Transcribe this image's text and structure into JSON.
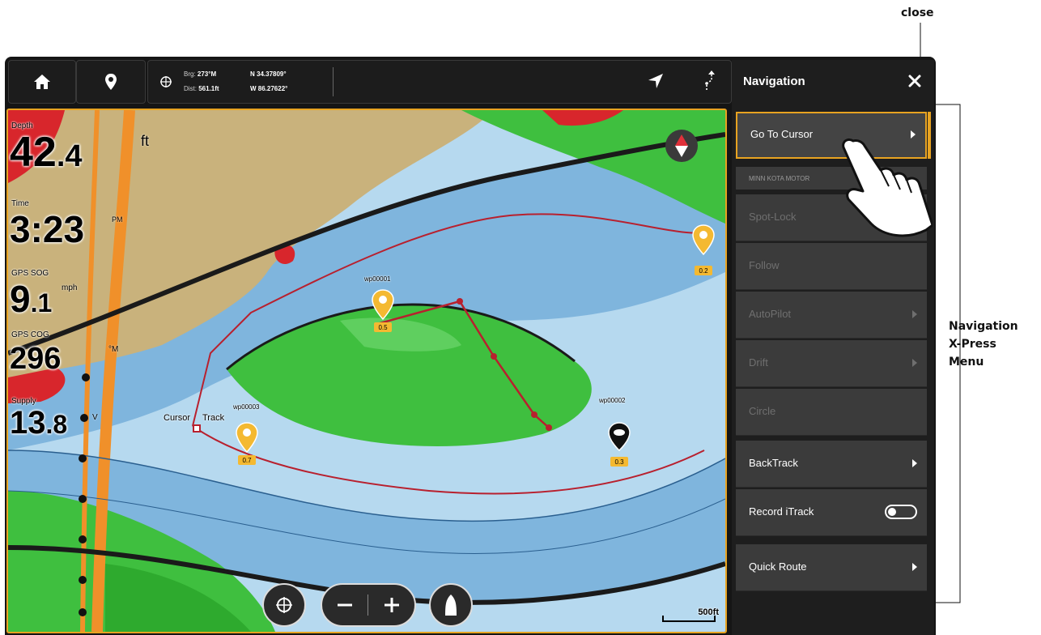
{
  "topbar": {
    "bearing_label": "Brg:",
    "bearing_value": "273°M",
    "distance_label": "Dist:",
    "distance_value": "561.1ft",
    "latitude": "N 34.37809°",
    "longitude": "W 86.27622°"
  },
  "gauges": [
    {
      "label": "Depth",
      "value": "42",
      "decimal": ".4",
      "unit": "ft"
    },
    {
      "label": "Time",
      "value": "3:23",
      "decimal": "",
      "unit": "PM"
    },
    {
      "label": "GPS SOG",
      "value": "9",
      "decimal": ".1",
      "unit": "mph"
    },
    {
      "label": "GPS COG",
      "value": "296",
      "decimal": "",
      "unit": "°M"
    },
    {
      "label": "Supply",
      "value": "13",
      "decimal": ".8",
      "unit": "V"
    }
  ],
  "map": {
    "cursor_label": "Cursor",
    "track_label": "Track",
    "waypoint_labels": [
      "wp00001",
      "wp00002",
      "wp00003"
    ],
    "waypoint_tags": [
      "0.5",
      "0.7",
      "0.3",
      "0.2"
    ],
    "scale_label": "500ft"
  },
  "panel": {
    "title": "Navigation",
    "items": [
      {
        "label": "Go To Cursor",
        "submenu": true,
        "active": true
      },
      {
        "label": "MINN KOTA MOTOR",
        "header": true
      },
      {
        "label": "Spot-Lock",
        "disabled": true
      },
      {
        "label": "Follow",
        "disabled": true
      },
      {
        "label": "AutoPilot",
        "submenu": true,
        "disabled": true
      },
      {
        "label": "Drift",
        "submenu": true,
        "disabled": true
      },
      {
        "label": "Circle",
        "disabled": true
      },
      {
        "label": "BackTrack",
        "submenu": true
      },
      {
        "label": "Record iTrack",
        "toggle": false
      },
      {
        "label": "Quick Route",
        "submenu": true
      }
    ]
  },
  "annotations": {
    "close": "close",
    "menu_line1": "Navigation",
    "menu_line2": "X-Press",
    "menu_line3": "Menu"
  },
  "colors": {
    "accent": "#e8a321",
    "water": "#b6d9ef",
    "land": "#c9b27c",
    "vegetation": "#3fbf3f",
    "route": "#b8202e"
  }
}
